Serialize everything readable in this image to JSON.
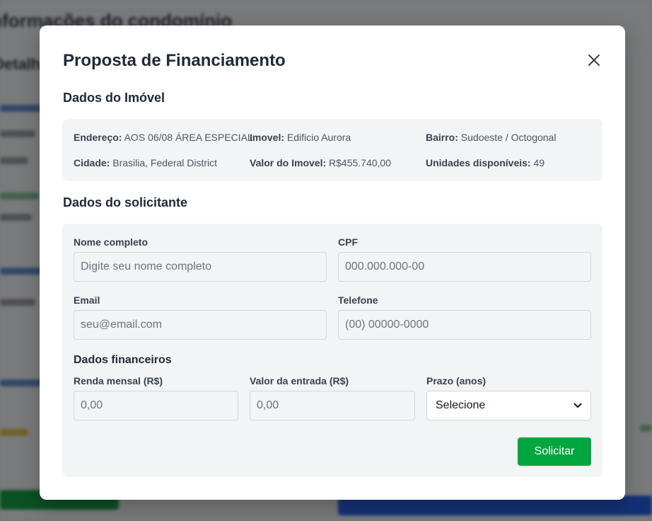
{
  "background": {
    "page_title": "Informações do condomínio",
    "page_subtitle": "Detalhes"
  },
  "modal": {
    "title": "Proposta de Financiamento",
    "close_icon": "close-icon"
  },
  "property": {
    "section_title": "Dados do Imóvel",
    "items": [
      {
        "label": "Endereço:",
        "value": "AOS 06/08 ÁREA ESPECIAL"
      },
      {
        "label": "Imovel:",
        "value": "Edificio Aurora"
      },
      {
        "label": "Bairro:",
        "value": "Sudoeste / Octogonal"
      },
      {
        "label": "Cidade:",
        "value": "Brasilia, Federal District"
      },
      {
        "label": "Valor do Imovel:",
        "value": "R$455.740,00"
      },
      {
        "label": "Unidades disponíveis:",
        "value": "49"
      }
    ]
  },
  "applicant": {
    "section_title": "Dados do solicitante",
    "full_name": {
      "label": "Nome completo",
      "placeholder": "Digite seu nome completo"
    },
    "cpf": {
      "label": "CPF",
      "placeholder": "000.000.000-00"
    },
    "email": {
      "label": "Email",
      "placeholder": "seu@email.com"
    },
    "phone": {
      "label": "Telefone",
      "placeholder": "(00) 00000-0000"
    },
    "financial_title": "Dados financeiros",
    "income": {
      "label": "Renda mensal (R$)",
      "placeholder": "0,00"
    },
    "down_payment": {
      "label": "Valor da entrada (R$)",
      "placeholder": "0,00"
    },
    "term": {
      "label": "Prazo (anos)",
      "selected": "Selecione"
    },
    "submit_label": "Solicitar"
  },
  "colors": {
    "submit_button": "#00a63e",
    "panel_background": "#f3f4f6"
  }
}
